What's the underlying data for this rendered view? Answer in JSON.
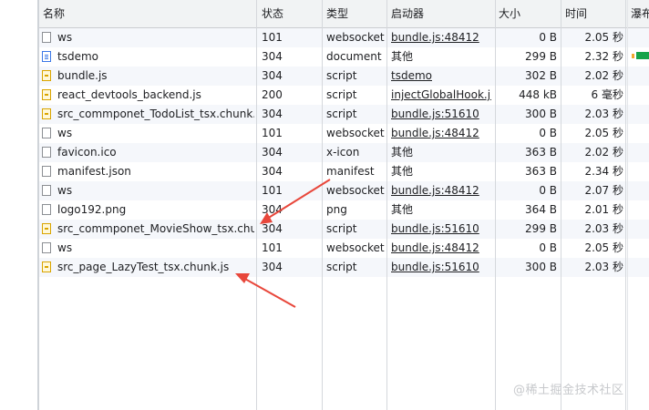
{
  "headers": {
    "name": "名称",
    "status": "状态",
    "type": "类型",
    "initiator": "启动器",
    "size": "大小",
    "time": "时间",
    "waterfall": "瀑布"
  },
  "rows": [
    {
      "name": "ws",
      "icon": "blank-file-icon",
      "status": "101",
      "type": "websocket",
      "initiator": "bundle.js:48412",
      "initiator_link": true,
      "size": "0 B",
      "time": "2.05 秒"
    },
    {
      "name": "tsdemo",
      "icon": "document-icon",
      "status": "304",
      "type": "document",
      "initiator": "其他",
      "initiator_link": false,
      "size": "299 B",
      "time": "2.32 秒"
    },
    {
      "name": "bundle.js",
      "icon": "script-icon",
      "status": "304",
      "type": "script",
      "initiator": "tsdemo",
      "initiator_link": true,
      "size": "302 B",
      "time": "2.02 秒"
    },
    {
      "name": "react_devtools_backend.js",
      "icon": "script-icon",
      "status": "200",
      "type": "script",
      "initiator": "injectGlobalHook.j...",
      "initiator_link": true,
      "size": "448 kB",
      "time": "6 毫秒"
    },
    {
      "name": "src_commponet_TodoList_tsx.chunk.js",
      "icon": "script-icon",
      "status": "304",
      "type": "script",
      "initiator": "bundle.js:51610",
      "initiator_link": true,
      "size": "300 B",
      "time": "2.03 秒"
    },
    {
      "name": "ws",
      "icon": "blank-file-icon",
      "status": "101",
      "type": "websocket",
      "initiator": "bundle.js:48412",
      "initiator_link": true,
      "size": "0 B",
      "time": "2.05 秒"
    },
    {
      "name": "favicon.ico",
      "icon": "blank-file-icon",
      "status": "304",
      "type": "x-icon",
      "initiator": "其他",
      "initiator_link": false,
      "size": "363 B",
      "time": "2.02 秒"
    },
    {
      "name": "manifest.json",
      "icon": "blank-file-icon",
      "status": "304",
      "type": "manifest",
      "initiator": "其他",
      "initiator_link": false,
      "size": "363 B",
      "time": "2.34 秒"
    },
    {
      "name": "ws",
      "icon": "blank-file-icon",
      "status": "101",
      "type": "websocket",
      "initiator": "bundle.js:48412",
      "initiator_link": true,
      "size": "0 B",
      "time": "2.07 秒"
    },
    {
      "name": "logo192.png",
      "icon": "blank-file-icon",
      "status": "304",
      "type": "png",
      "initiator": "其他",
      "initiator_link": false,
      "size": "364 B",
      "time": "2.01 秒"
    },
    {
      "name": "src_commponet_MovieShow_tsx.chun...",
      "icon": "script-icon",
      "status": "304",
      "type": "script",
      "initiator": "bundle.js:51610",
      "initiator_link": true,
      "size": "299 B",
      "time": "2.03 秒"
    },
    {
      "name": "ws",
      "icon": "blank-file-icon",
      "status": "101",
      "type": "websocket",
      "initiator": "bundle.js:48412",
      "initiator_link": true,
      "size": "0 B",
      "time": "2.05 秒"
    },
    {
      "name": "src_page_LazyTest_tsx.chunk.js",
      "icon": "script-icon",
      "status": "304",
      "type": "script",
      "initiator": "bundle.js:51610",
      "initiator_link": true,
      "size": "300 B",
      "time": "2.03 秒"
    }
  ],
  "watermark": "@稀土掘金技术社区",
  "colors": {
    "arrow": "#e8473b",
    "waterfall_green": "#17a34a",
    "waterfall_orange": "#f0a830",
    "link": "#202124"
  }
}
